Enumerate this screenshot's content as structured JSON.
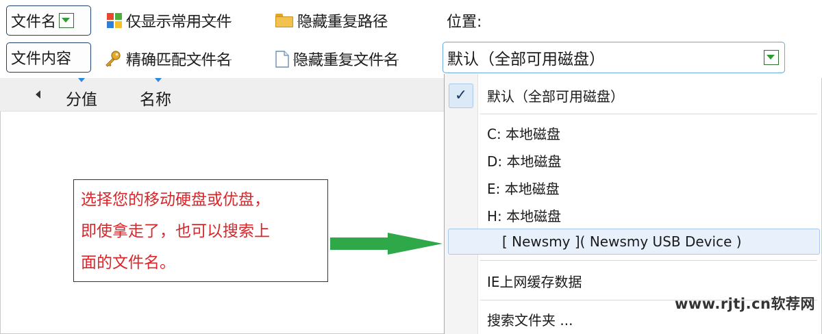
{
  "toolbar": {
    "row1": {
      "filename_btn": "文件名",
      "only_common": "仅显示常用文件",
      "hide_dup_path": "隐藏重复路径",
      "location_label": "位置:"
    },
    "row2": {
      "content_btn": "文件内容",
      "exact_match": "精确匹配文件名",
      "hide_dup_name": "隐藏重复文件名",
      "location_value": "默认（全部可用磁盘）"
    }
  },
  "columns": [
    "分值",
    "名称"
  ],
  "dropdown": {
    "options": [
      {
        "label": "默认（全部可用磁盘）",
        "checked": true
      },
      {
        "label": "C: 本地磁盘"
      },
      {
        "label": "D: 本地磁盘"
      },
      {
        "label": "E: 本地磁盘"
      },
      {
        "label": "H: 本地磁盘"
      },
      {
        "label": "[ Newsmy ]( Newsmy USB Device )",
        "highlighted": true
      },
      {
        "label": "IE上网缓存数据"
      },
      {
        "label": "搜索文件夹 ..."
      }
    ]
  },
  "callout": {
    "lines": [
      "选择您的移动硬盘或优盘，",
      "即使拿走了，也可以搜索上",
      "面的文件名。"
    ],
    "color": "#d8262a"
  },
  "arrow_color": "#2fa84a",
  "watermark": "www.rjtj.cn软荐网"
}
